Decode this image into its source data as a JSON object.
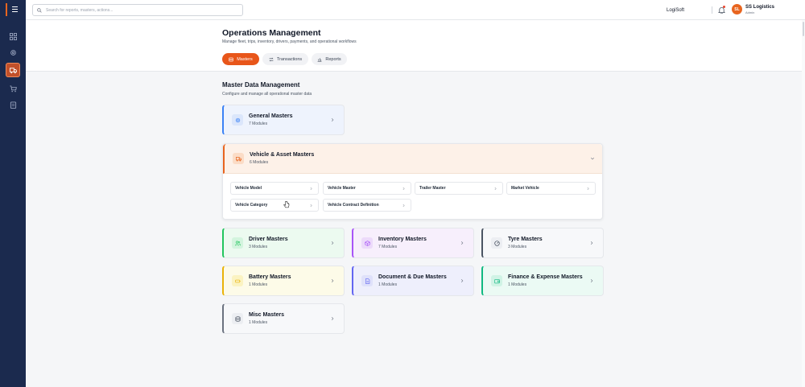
{
  "topbar": {
    "search_placeholder": "Search for reports, masters, actions...",
    "brand_name": "LogiSoft",
    "avatar_initials": "SL",
    "user_name": "SS Logistics",
    "user_role": "Admin"
  },
  "header": {
    "title": "Operations Management",
    "subtitle": "Manage fleet, trips, inventory, drivers, payments, and operational workflows",
    "tabs": [
      {
        "label": "Masters",
        "icon": "database-icon",
        "active": true
      },
      {
        "label": "Transactions",
        "icon": "arrows-swap-icon",
        "active": false
      },
      {
        "label": "Reports",
        "icon": "bar-chart-icon",
        "active": false
      }
    ]
  },
  "section": {
    "title": "Master Data Management",
    "subtitle": "Configure and manage all operational master data"
  },
  "cards": {
    "general": {
      "title": "General Masters",
      "sub": "7 Modules",
      "color": "#3b82f6"
    },
    "vehicle": {
      "title": "Vehicle & Asset Masters",
      "sub": "6 Modules",
      "color": "#e8651f"
    },
    "driver": {
      "title": "Driver Masters",
      "sub": "3 Modules",
      "color": "#22c55e"
    },
    "inventory": {
      "title": "Inventory Masters",
      "sub": "7 Modules",
      "color": "#a855f7"
    },
    "tyre": {
      "title": "Tyre Masters",
      "sub": "3 Modules",
      "color": "#4b5563"
    },
    "battery": {
      "title": "Battery Masters",
      "sub": "1 Modules",
      "color": "#eab308"
    },
    "document": {
      "title": "Document & Due Masters",
      "sub": "1 Modules",
      "color": "#6366f1"
    },
    "finance": {
      "title": "Finance & Expense Masters",
      "sub": "1 Modules",
      "color": "#10b981"
    },
    "misc": {
      "title": "Misc Masters",
      "sub": "1 Modules",
      "color": "#6b7280"
    }
  },
  "vehicle_modules": [
    "Vehicle Model",
    "Vehicle Master",
    "Trailer Master",
    "Market Vehicle",
    "Vehicle Category",
    "Vehicle Contract Definition"
  ]
}
